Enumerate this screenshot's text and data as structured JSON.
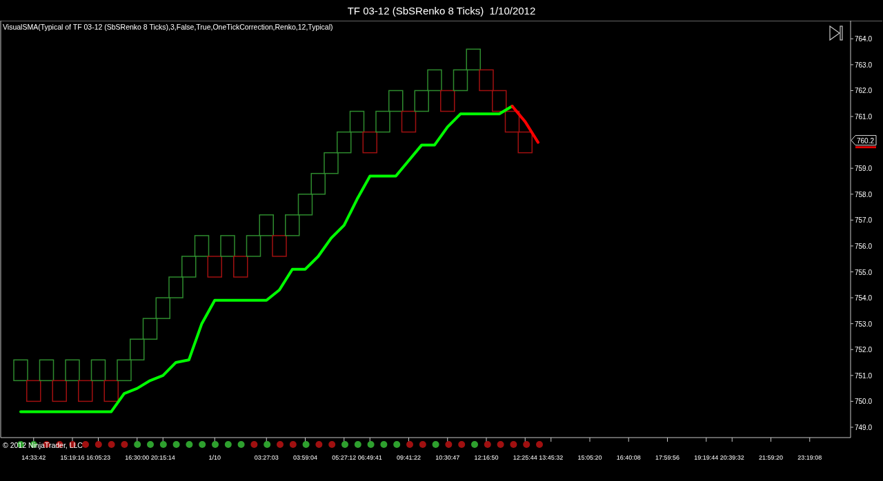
{
  "window": {
    "title": "TF 03-12 (SbSRenko 8 Ticks)  1/10/2012"
  },
  "chart": {
    "legend": "VisualSMA(Typical of TF 03-12 (SbSRenko 8 Ticks),3,False,True,OneTickCorrection,Renko,12,Typical)",
    "copyright": "© 2012 NinjaTrader, LLC",
    "price_marker": "760.2",
    "renko_bricks": [
      {
        "kind": "up"
      },
      {
        "kind": "down"
      },
      {
        "kind": "up"
      },
      {
        "kind": "down"
      },
      {
        "kind": "up"
      },
      {
        "kind": "down"
      },
      {
        "kind": "up"
      },
      {
        "kind": "down"
      },
      {
        "kind": "up"
      },
      {
        "kind": "up"
      },
      {
        "kind": "up"
      },
      {
        "kind": "up"
      },
      {
        "kind": "up"
      },
      {
        "kind": "up"
      },
      {
        "kind": "up"
      },
      {
        "kind": "down"
      },
      {
        "kind": "up"
      },
      {
        "kind": "down"
      },
      {
        "kind": "up"
      },
      {
        "kind": "up"
      },
      {
        "kind": "down"
      },
      {
        "kind": "up"
      },
      {
        "kind": "up"
      },
      {
        "kind": "up"
      },
      {
        "kind": "up"
      },
      {
        "kind": "up"
      },
      {
        "kind": "up"
      },
      {
        "kind": "down"
      },
      {
        "kind": "up"
      },
      {
        "kind": "up"
      },
      {
        "kind": "down"
      },
      {
        "kind": "up"
      },
      {
        "kind": "up"
      },
      {
        "kind": "down"
      },
      {
        "kind": "up"
      },
      {
        "kind": "up"
      },
      {
        "kind": "down"
      },
      {
        "kind": "down"
      },
      {
        "kind": "down"
      },
      {
        "kind": "down"
      }
    ],
    "chart_data": {
      "type": "line",
      "ylim": [
        748.6,
        764.7
      ],
      "categories": [
        null,
        "14:33:42",
        null,
        null,
        "15:19:16",
        null,
        "16:05:23",
        null,
        null,
        "16:30:00",
        null,
        "20:15:14",
        null,
        null,
        null,
        "1/10",
        null,
        null,
        null,
        "03:27:03",
        null,
        null,
        "03:59:04",
        null,
        null,
        "05:27:12",
        null,
        "06:49:41",
        null,
        null,
        "09:41:22",
        null,
        null,
        "10:30:47",
        null,
        null,
        "12:16:50",
        null,
        null,
        "12:25:44",
        null,
        "13:45:32",
        null,
        null,
        "15:05:20",
        null,
        null,
        "16:40:08",
        null,
        null,
        "17:59:56",
        null,
        null,
        "19:19:44",
        null,
        "20:39:32",
        null,
        null,
        "21:59:20",
        null,
        null,
        "23:19:08"
      ],
      "yticks": [
        {
          "value": 764,
          "label": "764.0"
        },
        {
          "value": 763,
          "label": "763.0"
        },
        {
          "value": 762,
          "label": "762.0"
        },
        {
          "value": 761,
          "label": "761.0"
        },
        {
          "value": 759,
          "label": "759.0"
        },
        {
          "value": 758,
          "label": "758.0"
        },
        {
          "value": 757,
          "label": "757.0"
        },
        {
          "value": 756,
          "label": "756.0"
        },
        {
          "value": 755,
          "label": "755.0"
        },
        {
          "value": 754,
          "label": "754.0"
        },
        {
          "value": 753,
          "label": "753.0"
        },
        {
          "value": 752,
          "label": "752.0"
        },
        {
          "value": 751,
          "label": "751.0"
        },
        {
          "value": 750,
          "label": "750.0"
        },
        {
          "value": 749,
          "label": "749.0"
        }
      ],
      "series": [
        {
          "color": "#00ff00",
          "values": [
            749.6,
            749.6,
            749.6,
            749.6,
            749.6,
            749.6,
            749.6,
            749.6,
            750.3,
            750.5,
            750.8,
            751.0,
            751.5,
            751.6,
            753.0,
            753.9,
            753.9,
            753.9,
            753.9,
            753.9,
            754.3,
            755.1,
            755.1,
            755.6,
            756.3,
            756.8,
            757.8,
            758.7,
            758.7,
            758.7,
            759.3,
            759.9,
            759.9,
            760.6,
            761.1,
            761.1,
            761.1,
            761.1,
            761.4,
            null,
            null,
            null,
            null,
            null,
            null,
            null,
            null,
            null,
            null,
            null,
            null,
            null,
            null,
            null,
            null,
            null,
            null,
            null,
            null,
            null,
            null,
            null
          ]
        },
        {
          "color": "#ff0000",
          "values": [
            null,
            null,
            null,
            null,
            null,
            null,
            null,
            null,
            null,
            null,
            null,
            null,
            null,
            null,
            null,
            null,
            null,
            null,
            null,
            null,
            null,
            null,
            null,
            null,
            null,
            null,
            null,
            null,
            null,
            null,
            null,
            null,
            null,
            null,
            null,
            null,
            null,
            null,
            761.4,
            760.8,
            760.0,
            null,
            null,
            null,
            null,
            null,
            null,
            null,
            null,
            null,
            null,
            null,
            null,
            null,
            null,
            null,
            null,
            null,
            null,
            null,
            null,
            null
          ]
        }
      ]
    },
    "indicator_dots": [
      {
        "color": "#2ea02e"
      },
      {
        "color": "#2ea02e"
      },
      {
        "color": "#a01010"
      },
      {
        "color": "#a01010"
      },
      {
        "color": "#a01010"
      },
      {
        "color": "#a01010"
      },
      {
        "color": "#a01010"
      },
      {
        "color": "#a01010"
      },
      {
        "color": "#a01010"
      },
      {
        "color": "#2ea02e"
      },
      {
        "color": "#2ea02e"
      },
      {
        "color": "#2ea02e"
      },
      {
        "color": "#2ea02e"
      },
      {
        "color": "#2ea02e"
      },
      {
        "color": "#2ea02e"
      },
      {
        "color": "#2ea02e"
      },
      {
        "color": "#2ea02e"
      },
      {
        "color": "#2ea02e"
      },
      {
        "color": "#a01010"
      },
      {
        "color": "#2ea02e"
      },
      {
        "color": "#a01010"
      },
      {
        "color": "#a01010"
      },
      {
        "color": "#2ea02e"
      },
      {
        "color": "#a01010"
      },
      {
        "color": "#a01010"
      },
      {
        "color": "#2ea02e"
      },
      {
        "color": "#2ea02e"
      },
      {
        "color": "#2ea02e"
      },
      {
        "color": "#2ea02e"
      },
      {
        "color": "#2ea02e"
      },
      {
        "color": "#a01010"
      },
      {
        "color": "#a01010"
      },
      {
        "color": "#2ea02e"
      },
      {
        "color": "#a01010"
      },
      {
        "color": "#a01010"
      },
      {
        "color": "#2ea02e"
      },
      {
        "color": "#a01010"
      },
      {
        "color": "#a01010"
      },
      {
        "color": "#a01010"
      },
      {
        "color": "#a01010"
      },
      {
        "color": "#a01010"
      }
    ]
  }
}
